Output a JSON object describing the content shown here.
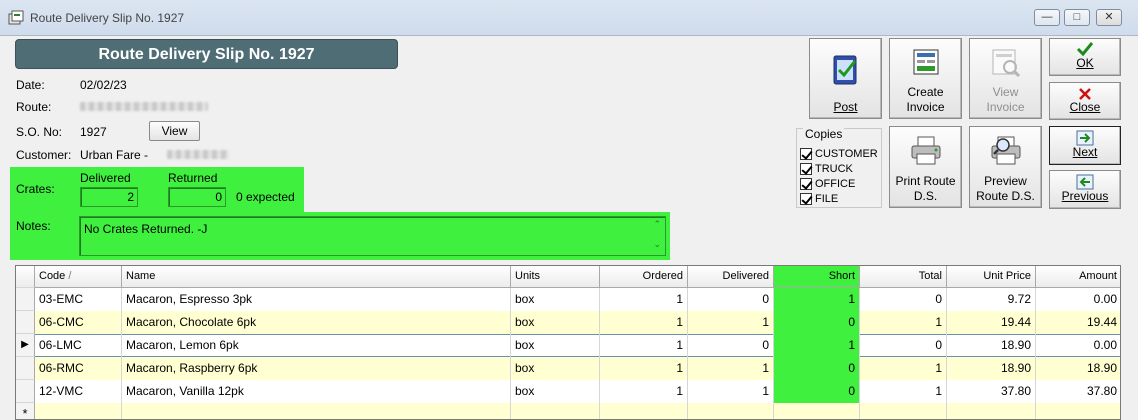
{
  "window": {
    "title": "Route Delivery Slip No. 1927",
    "controls": {
      "minimize": "—",
      "maximize": "□",
      "close": "✕"
    }
  },
  "header": {
    "banner": "Route Delivery Slip No. 1927"
  },
  "info": {
    "date_label": "Date:",
    "date": "02/02/23",
    "route_label": "Route:",
    "so_label": "S.O. No:",
    "so_no": "1927",
    "view_button": "View",
    "customer_label": "Customer:",
    "customer": "Urban Fare -"
  },
  "crates": {
    "label": "Crates:",
    "delivered_label": "Delivered",
    "delivered": "2",
    "returned_label": "Returned",
    "returned": "0",
    "expected": "0 expected"
  },
  "notes": {
    "label": "Notes:",
    "text": "No Crates Returned. -J"
  },
  "actions": {
    "post": "Post",
    "create_invoice": [
      "Create",
      "Invoice"
    ],
    "view_invoice": [
      "View",
      "Invoice"
    ],
    "ok": "OK",
    "close": "Close",
    "print_route": [
      "Print Route",
      "D.S."
    ],
    "preview_route": [
      "Preview",
      "Route D.S."
    ],
    "next": "Next",
    "previous": "Previous"
  },
  "copies": {
    "legend": "Copies",
    "items": [
      {
        "label": "CUSTOMER",
        "checked": true
      },
      {
        "label": "TRUCK",
        "checked": true
      },
      {
        "label": "OFFICE",
        "checked": true
      },
      {
        "label": "FILE",
        "checked": true
      }
    ]
  },
  "grid": {
    "columns": [
      "Code",
      "Name",
      "Units",
      "Ordered",
      "Delivered",
      "Short",
      "Total",
      "Unit Price",
      "Amount"
    ],
    "sort_indicator": "/",
    "current_row_marker": "▶",
    "new_row_marker": "*",
    "rows": [
      [
        "03-EMC",
        "Macaron, Espresso 3pk",
        "box",
        "1",
        "0",
        "1",
        "0",
        "9.72",
        "0.00"
      ],
      [
        "06-CMC",
        "Macaron, Chocolate 6pk",
        "box",
        "1",
        "1",
        "0",
        "1",
        "19.44",
        "19.44"
      ],
      [
        "06-LMC",
        "Macaron, Lemon 6pk",
        "box",
        "1",
        "0",
        "1",
        "0",
        "18.90",
        "0.00"
      ],
      [
        "06-RMC",
        "Macaron, Raspberry 6pk",
        "box",
        "1",
        "1",
        "0",
        "1",
        "18.90",
        "18.90"
      ],
      [
        "12-VMC",
        "Macaron, Vanilla 12pk",
        "box",
        "1",
        "1",
        "0",
        "1",
        "37.80",
        "37.80"
      ]
    ]
  },
  "colors": {
    "highlight": "#3ff03f",
    "banner": "#4f6d75",
    "alt_row": "#ffffd2"
  }
}
